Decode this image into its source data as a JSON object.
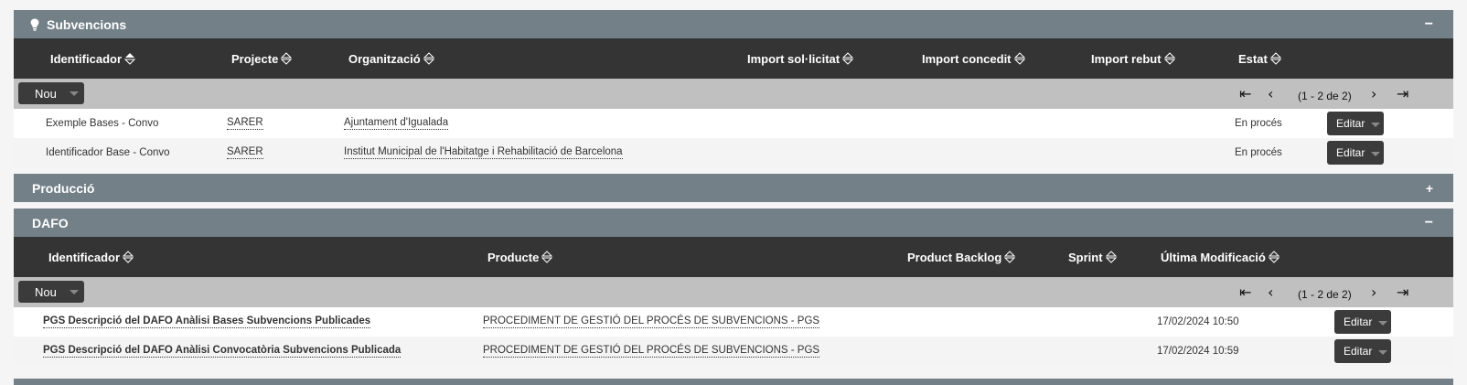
{
  "subvencions": {
    "title": "Subvencions",
    "toggle": "−",
    "columns": [
      "Identificador",
      "Projecte",
      "Organització",
      "Import sol·licitat",
      "Import concedit",
      "Import rebut",
      "Estat"
    ],
    "new_label": "Nou",
    "pager_info": "(1 - 2 de 2)",
    "rows": [
      {
        "identificador": "Exemple Bases - Convo",
        "projecte": "SARER",
        "organitzacio": "Ajuntament d'Igualada",
        "estat": "En procés",
        "edit": "Editar"
      },
      {
        "identificador": "Identificador Base - Convo",
        "projecte": "SARER",
        "organitzacio": "Institut Municipal de l'Habitatge i Rehabilitació de Barcelona",
        "estat": "En procés",
        "edit": "Editar"
      }
    ]
  },
  "produccio": {
    "title": "Producció",
    "toggle": "+"
  },
  "dafo": {
    "title": "DAFO",
    "toggle": "−",
    "columns": [
      "Identificador",
      "Producte",
      "Product Backlog",
      "Sprint",
      "Última Modificació"
    ],
    "new_label": "Nou",
    "pager_info": "(1 - 2 de 2)",
    "rows": [
      {
        "identificador": "PGS Descripció del DAFO Anàlisi Bases Subvencions Publicades",
        "producte": "PROCEDIMENT DE GESTIÓ DEL PROCÉS DE SUBVENCIONS - PGS",
        "modificacio": "17/02/2024 10:50",
        "edit": "Editar"
      },
      {
        "identificador": "PGS Descripció del DAFO Anàlisi Convocatòria Subvencions Publicada",
        "producte": "PROCEDIMENT DE GESTIÓ DEL PROCÉS DE SUBVENCIONS - PGS",
        "modificacio": "17/02/2024 10:59",
        "edit": "Editar"
      }
    ]
  },
  "colors": {
    "panel_header": "#738088",
    "table_header": "#343434",
    "toolbar": "#c0c0c0",
    "button": "#3b3b3b"
  },
  "icons": {
    "bulb": "lightbulb-icon",
    "sort": "sort-icon",
    "first": "first-page-icon",
    "prev": "prev-page-icon",
    "next": "next-page-icon",
    "last": "last-page-icon",
    "caret": "chevron-down-icon"
  }
}
